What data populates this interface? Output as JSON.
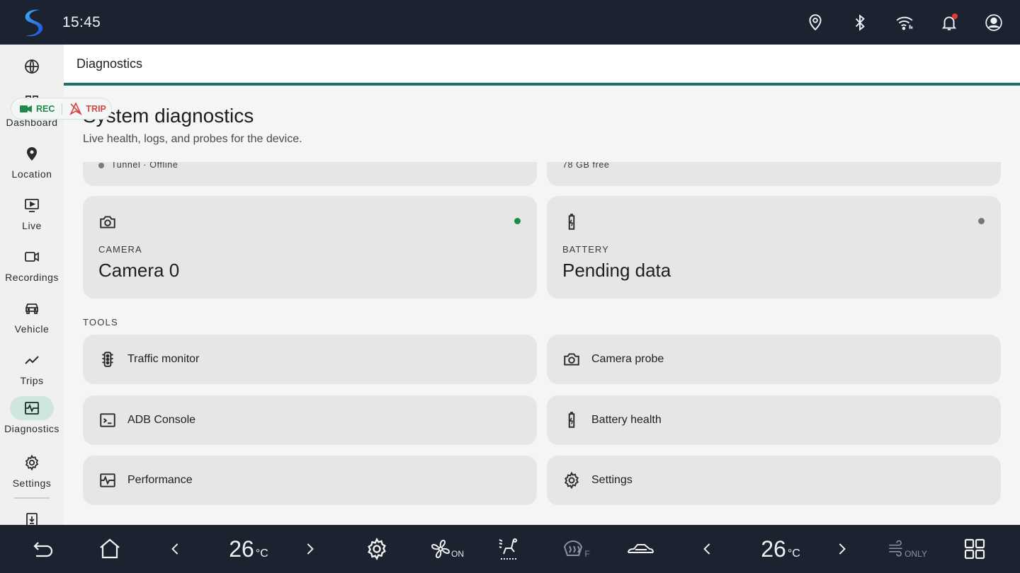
{
  "status_bar": {
    "time": "15:45",
    "icons": [
      "location-pin-icon",
      "bluetooth-icon",
      "wifi-icon",
      "bell-icon",
      "account-icon"
    ],
    "notification_dot_color": "#e53935"
  },
  "sidebar": {
    "items": [
      {
        "label": "",
        "icon": "globe-icon"
      },
      {
        "label": "Dashboard",
        "icon": "dashboard-icon"
      },
      {
        "label": "Location",
        "icon": "location-icon"
      },
      {
        "label": "Live",
        "icon": "live-icon"
      },
      {
        "label": "Recordings",
        "icon": "recordings-icon"
      },
      {
        "label": "Vehicle",
        "icon": "car-icon"
      },
      {
        "label": "Trips",
        "icon": "trips-icon"
      },
      {
        "label": "Diagnostics",
        "icon": "diagnostics-icon",
        "active": true
      },
      {
        "label": "Settings",
        "icon": "gear-icon"
      },
      {
        "label": "",
        "icon": "download-icon"
      }
    ],
    "active_color": "#cfe6dc"
  },
  "pill": {
    "rec_label": "REC",
    "trip_label": "TRIP"
  },
  "header": {
    "title": "Diagnostics",
    "accent_color": "#1e6f6a"
  },
  "main": {
    "title": "System diagnostics",
    "subtitle": "Live health, logs, and probes for the device.",
    "partial_cards": [
      {
        "text": "Tunnel · Offline"
      },
      {
        "text": "78 GB free"
      }
    ],
    "cards": [
      {
        "caption": "CAMERA",
        "value": "Camera 0",
        "icon": "camera-icon",
        "status_color": "#1e8a4c"
      },
      {
        "caption": "BATTERY",
        "value": "Pending data",
        "icon": "battery-icon",
        "status_color": "#777777"
      }
    ],
    "tools_label": "TOOLS",
    "tools": [
      {
        "label": "Traffic monitor",
        "icon": "traffic-light-icon"
      },
      {
        "label": "Camera probe",
        "icon": "camera-icon"
      },
      {
        "label": "ADB Console",
        "icon": "terminal-icon"
      },
      {
        "label": "Battery health",
        "icon": "battery-icon"
      },
      {
        "label": "Performance",
        "icon": "performance-icon"
      },
      {
        "label": "Settings",
        "icon": "gear-icon"
      }
    ]
  },
  "climate_bar": {
    "left_temp": "26",
    "right_temp": "26",
    "unit": "°C",
    "fan_label": "ON",
    "rear_defrost_label": "F",
    "ac_label": "ONLY"
  }
}
